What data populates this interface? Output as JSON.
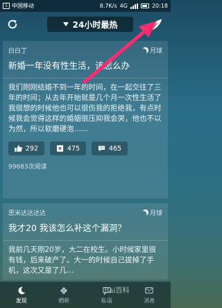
{
  "status_bar": {
    "carrier": "中国移动",
    "speed": "8.7K/s",
    "signal_text": "4G",
    "time": "20:18"
  },
  "header": {
    "title": "24小时最热"
  },
  "posts": [
    {
      "author": "白白丁",
      "moon_label": "月球",
      "title": "新婚一年没有性生活，该怎么办",
      "body": "我们刚刚结婚不到一年的时间，在一起交往了三年的时间；从去年开始就是几个月一次性生活了我很想的时候他也可以很伤我的拒绝我，有点时候我会觉得这样的婚姻很压抑我会哭，他也不以为然，所以软磨硬泡……",
      "likes": "292",
      "saves": "475",
      "comments": "465",
      "reads": "99683次阅读"
    },
    {
      "author": "思米达达达达",
      "moon_label": "月球",
      "title": "我才20 我该怎么补这个漏洞？",
      "body": "我前几天刚20岁，大二在校生。小时候家里很有钱，后来破产了。大一的时候自己拔掉了手机，这次又是了几…"
    }
  ],
  "bottom_nav": {
    "items": [
      {
        "label": "发现",
        "icon": "moon-icon"
      },
      {
        "label": "晒新",
        "icon": "flower-icon"
      },
      {
        "label": "私语",
        "icon": "chat-icon"
      },
      {
        "label": "消息",
        "icon": "message-icon"
      }
    ]
  },
  "watermark": "Bai百科",
  "colors": {
    "arrow": "#ff2b6e",
    "accent": "#ffffff"
  }
}
